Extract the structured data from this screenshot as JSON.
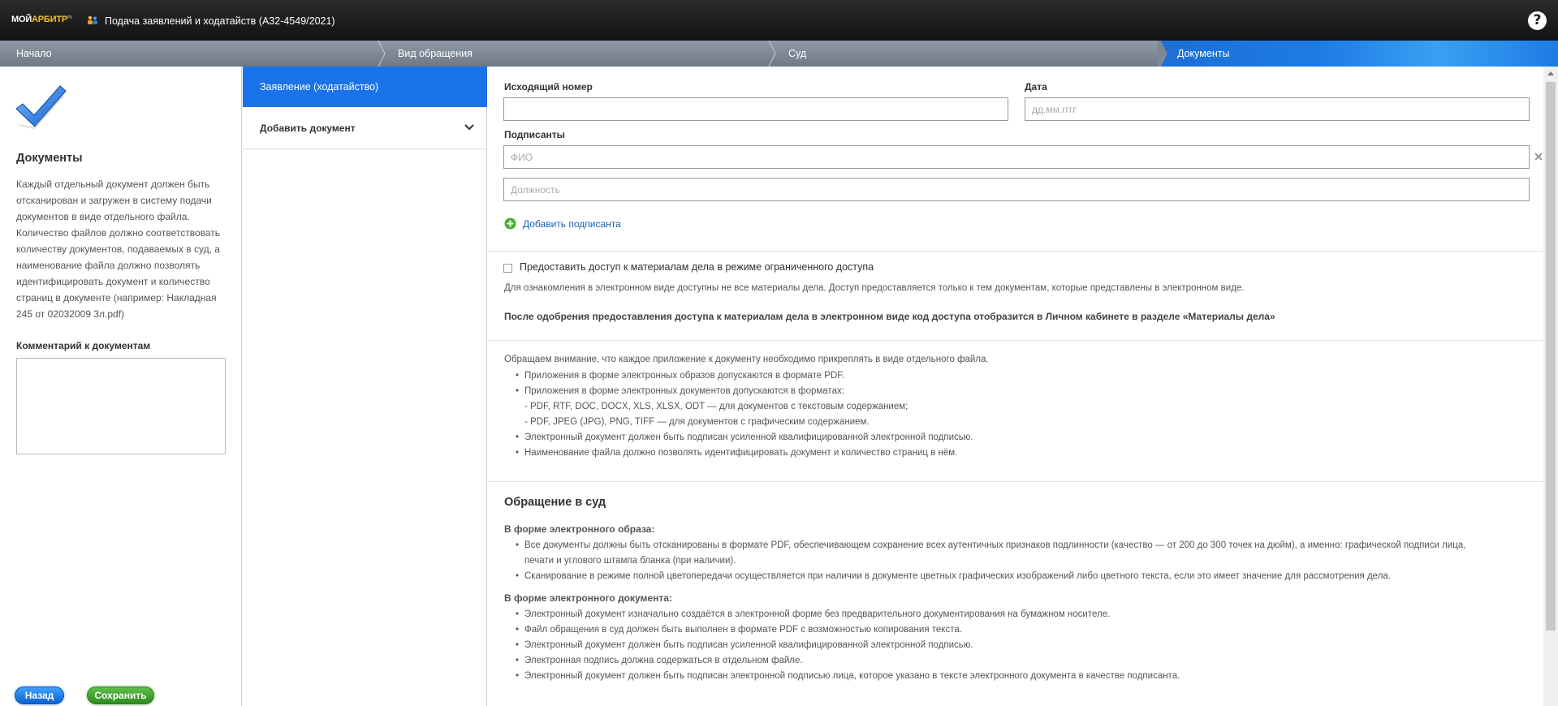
{
  "header": {
    "logo_main": "МОЙ",
    "logo_accent": "АРБИТР",
    "logo_suffix": "ru",
    "title": "Подача заявлений и ходатайств  (А32-4549/2021)",
    "help_label": "?"
  },
  "steps": [
    {
      "label": "Начало"
    },
    {
      "label": "Вид обращения"
    },
    {
      "label": "Суд"
    },
    {
      "label": "Документы",
      "active": true
    }
  ],
  "sidebar": {
    "heading": "Документы",
    "description": "Каждый отдельный документ должен быть отсканирован и загружен в систему подачи документов в виде отдельного файла. Количество файлов должно соответствовать количеству документов, подаваемых в суд, а наименование файла должно позволять идентифицировать документ и количество страниц в документе (например: Накладная 245 от 02032009 3л.pdf)",
    "comment_label": "Комментарий к документам",
    "back_label": "Назад",
    "save_label": "Сохранить"
  },
  "nav": {
    "active_label": "Заявление (ходатайство)",
    "add_document_label": "Добавить документ"
  },
  "form": {
    "outgoing_number_label": "Исходящий номер",
    "outgoing_number_value": "",
    "date_label": "Дата",
    "date_placeholder": "дд.мм.гггг",
    "signers_label": "Подписанты",
    "fio_placeholder": "ФИО",
    "position_placeholder": "Должность",
    "add_signer_label": "Добавить подписанта"
  },
  "access": {
    "checkbox_label": "Предоставить доступ к материалам дела в режиме ограниченного доступа",
    "checked": false,
    "info": "Для ознакомления в электронном виде доступны не все материалы дела. Доступ предоставляется только к тем документам, которые представлены в электронном виде.",
    "note": "После одобрения предоставления доступа к материалам дела в электронном виде код доступа отобразится в Личном кабинете в разделе «Материалы дела»"
  },
  "attachments": {
    "intro": "Обращаем внимание, что каждое приложение к документу необходимо прикреплять в виде отдельного файла.",
    "items": [
      "Приложения в форме электронных образов допускаются в формате PDF.",
      "Приложения в форме электронных документов допускаются в форматах:",
      "Электронный документ должен быть подписан усиленной квалифицированной электронной подписью.",
      "Наименование файла должно позволять идентифицировать документ и количество страниц в нём."
    ],
    "formats_text": "- PDF, RTF, DOC, DOCX, XLS, XLSX, ODT — для документов с текстовым содержанием;",
    "formats_graphic": "- PDF, JPEG (JPG), PNG, TIFF — для документов с графическим содержанием."
  },
  "appeal": {
    "heading": "Обращение в суд",
    "image_heading": "В форме электронного образа:",
    "image_items": [
      "Все документы должны быть отсканированы в формате PDF, обеспечивающем сохранение всех аутентичных признаков подлинности (качество — от 200 до 300 точек на дюйм), а именно: графической подписи лица,",
      "печати и углового штампа бланка (при наличии).",
      "Сканирование в режиме полной цветопередачи осуществляется при наличии в документе цветных графических изображений либо цветного текста, если это имеет значение для рассмотрения дела."
    ],
    "doc_heading": "В форме электронного документа:",
    "doc_items": [
      "Электронный документ изначально создаётся в электронной форме без предварительного документирования на бумажном носителе.",
      "Файл обращения в суд должен быть выполнен в формате PDF с возможностью копирования текста.",
      "Электронный документ должен быть подписан усиленной квалифицированной электронной подписью.",
      "Электронная подпись должна содержаться в отдельном файле.",
      "Электронный документ должен быть подписан электронной подписью лица, которое указано в тексте электронного документа в качестве подписанта."
    ]
  },
  "colors": {
    "accent": "#1a73e8",
    "header_bg": "#1b1b1b",
    "steps_bg": "#7d8894",
    "save_green": "#3a9a28",
    "link": "#1a5fb4"
  }
}
